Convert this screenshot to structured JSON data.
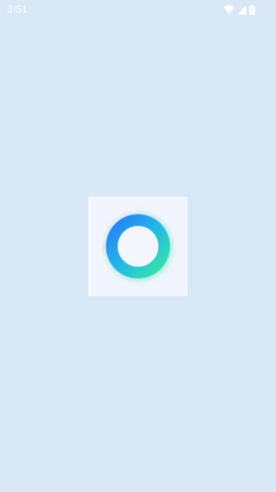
{
  "status_bar": {
    "time": "3:51",
    "icons": [
      "wifi-icon",
      "cell-signal-icon",
      "battery-icon"
    ]
  },
  "splash": {
    "logo_icon": "ring-logo-icon",
    "colors": {
      "background": "#d9e8f7",
      "tile": "#f2f5fd",
      "ring_blue": "#2f86f6",
      "ring_green": "#34e3a8"
    }
  }
}
